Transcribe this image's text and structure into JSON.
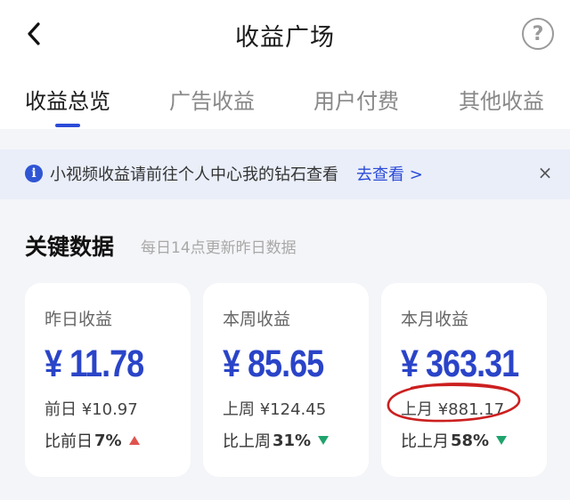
{
  "header": {
    "title": "收益广场",
    "back_icon": "chevron-left-icon",
    "help_icon": "question-circle-icon",
    "help_glyph": "?"
  },
  "tabs": [
    {
      "label": "收益总览",
      "active": true
    },
    {
      "label": "广告收益",
      "active": false
    },
    {
      "label": "用户付费",
      "active": false
    },
    {
      "label": "其他收益",
      "active": false
    }
  ],
  "banner": {
    "icon": "info-icon",
    "icon_glyph": "i",
    "text": "小视频收益请前往个人中心我的钻石查看",
    "link": "去查看 >",
    "close_glyph": "×"
  },
  "section": {
    "title": "关键数据",
    "subtitle": "每日14点更新昨日数据"
  },
  "cards": [
    {
      "label": "昨日收益",
      "amount": "¥ 11.78",
      "prev": "前日 ¥10.97",
      "cmp_label": "比前日",
      "cmp_pct": "7%",
      "trend": "up"
    },
    {
      "label": "本周收益",
      "amount": "¥ 85.65",
      "prev": "上周 ¥124.45",
      "cmp_label": "比上周",
      "cmp_pct": "31%",
      "trend": "down"
    },
    {
      "label": "本月收益",
      "amount": "¥ 363.31",
      "prev": "上月 ¥881.17",
      "cmp_label": "比上月",
      "cmp_pct": "58%",
      "trend": "down"
    }
  ],
  "colors": {
    "accent": "#2b4bd8",
    "amount": "#2a44c8",
    "up": "#e0534e",
    "down": "#1fa36c",
    "annotation": "#cc1f1f",
    "banner_bg": "#e9eef9",
    "page_bg": "#f4f5f8"
  }
}
